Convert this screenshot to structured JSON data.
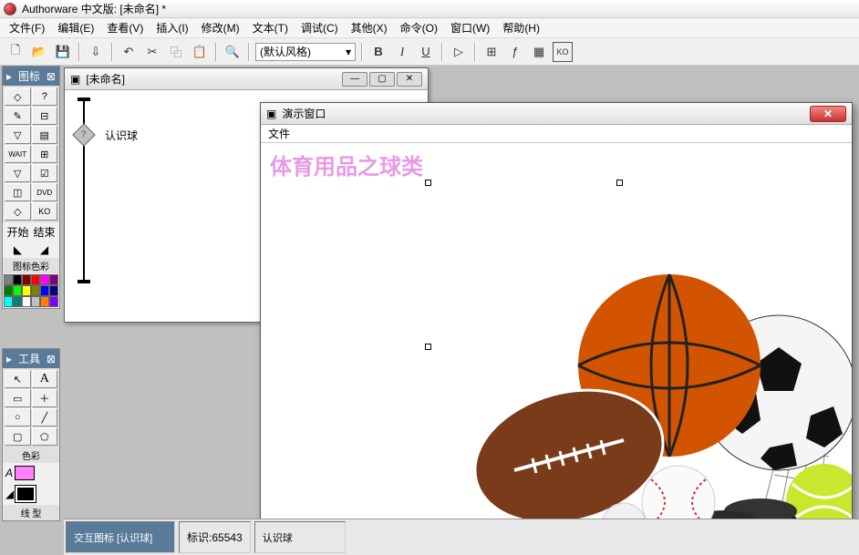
{
  "app": {
    "title": "Authorware 中文版: [未命名] *"
  },
  "menu": {
    "file": "文件(F)",
    "edit": "编辑(E)",
    "view": "查看(V)",
    "insert": "插入(I)",
    "modify": "修改(M)",
    "text": "文本(T)",
    "debug": "调试(C)",
    "other": "其他(X)",
    "command": "命令(O)",
    "window": "窗口(W)",
    "help": "帮助(H)"
  },
  "toolbar": {
    "style_default": "(默认风格)",
    "bold": "B",
    "italic": "I",
    "underline": "U"
  },
  "palettes": {
    "icons_title": "图标",
    "start": "开始",
    "end": "结束",
    "iconcolor": "图标色彩",
    "tools_title": "工具",
    "color_label": "色彩",
    "line_label": "线 型"
  },
  "flowline": {
    "window_title": "[未命名]",
    "node1": "认识球"
  },
  "presentation": {
    "title": "演示窗口",
    "menu_file": "文件",
    "heading": "体育用品之球类"
  },
  "status": {
    "interact": "交互图标 [认识球]",
    "id_label": "标识:",
    "id_value": "65543",
    "name": "认识球"
  },
  "colors": {
    "swatches": [
      "#808080",
      "#000000",
      "#800000",
      "#ff0000",
      "#ff00ff",
      "#800080",
      "#008000",
      "#00ff00",
      "#ffff00",
      "#808000",
      "#0000ff",
      "#000080",
      "#00ffff",
      "#008080",
      "#ffffff",
      "#c0c0c0",
      "#ff8000",
      "#8000ff"
    ]
  }
}
